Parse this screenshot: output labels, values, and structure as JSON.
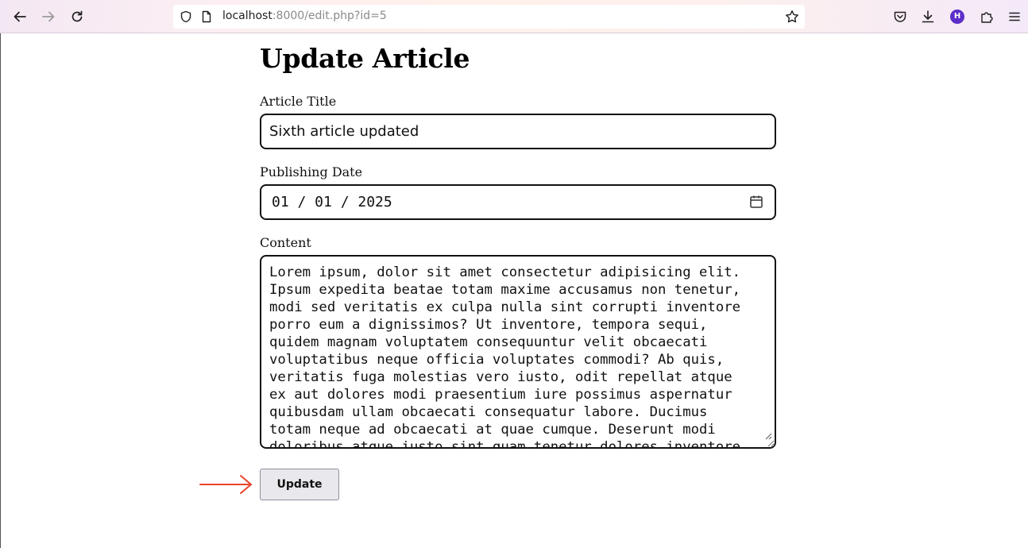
{
  "browser": {
    "url_host": "localhost",
    "url_rest": ":8000/edit.php?id=5",
    "profile_initial": "H"
  },
  "icons": {
    "back": "back-arrow-icon",
    "forward": "forward-arrow-icon",
    "reload": "reload-icon",
    "shield": "tracking-shield-icon",
    "page_info": "page-info-icon",
    "bookmark": "bookmark-star-icon",
    "pocket": "pocket-icon",
    "downloads": "download-icon",
    "extensions": "extensions-puzzle-icon",
    "menu": "hamburger-menu-icon",
    "calendar": "calendar-icon",
    "annotation_arrow": "red-arrow-icon"
  },
  "colors": {
    "annotation_arrow": "#e8432c",
    "avatar": "#5b2ec9",
    "button_bg": "#e9e9ed"
  },
  "form": {
    "heading": "Update Article",
    "title_label": "Article Title",
    "title_value": "Sixth article updated",
    "date_label": "Publishing Date",
    "date_value": "01 / 01 / 2025",
    "content_label": "Content",
    "content_value": "Lorem ipsum, dolor sit amet consectetur adipisicing elit.\nIpsum expedita beatae totam maxime accusamus non tenetur,\nmodi sed veritatis ex culpa nulla sint corrupti inventore\nporro eum a dignissimos? Ut inventore, tempora sequi,\nquidem magnam voluptatem consequuntur velit obcaecati\nvoluptatibus neque officia voluptates commodi? Ab quis,\nveritatis fuga molestias vero iusto, odit repellat atque\nex aut dolores modi praesentium iure possimus aspernatur\nquibusdam ullam obcaecati consequatur labore. Ducimus\ntotam neque ad obcaecati at quae cumque. Deserunt modi\ndoloribus atque iusto sint quam tenetur dolores inventore",
    "submit_label": "Update"
  }
}
